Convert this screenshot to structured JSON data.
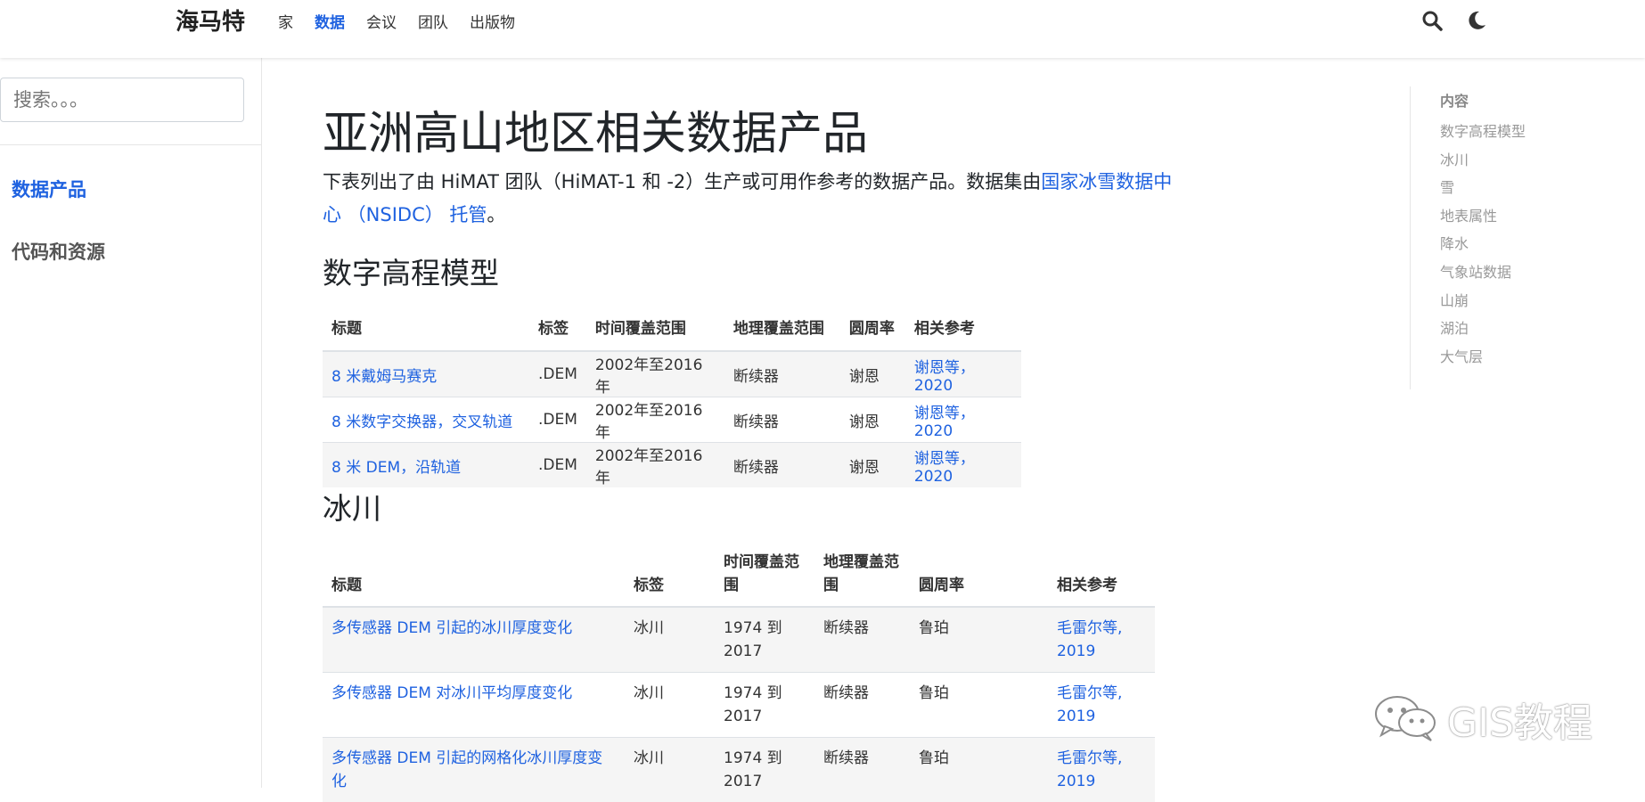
{
  "navbar": {
    "brand": "海马特",
    "links": [
      {
        "label": "家",
        "active": false
      },
      {
        "label": "数据",
        "active": true
      },
      {
        "label": "会议",
        "active": false
      },
      {
        "label": "团队",
        "active": false
      },
      {
        "label": "出版物",
        "active": false
      }
    ],
    "icons": [
      "search-icon",
      "moon-icon"
    ]
  },
  "sidebar": {
    "search_placeholder": "搜索。。。",
    "items": [
      {
        "label": "数据产品",
        "active": true
      },
      {
        "label": "代码和资源",
        "active": false
      }
    ]
  },
  "main": {
    "title": "亚洲高山地区相关数据产品",
    "intro_before": "下表列出了由 HiMAT 团队（HiMAT-1 和 -2）生产或可用作参考的数据产品。数据集由",
    "intro_link": "国家冰雪数据中心 （NSIDC） 托管",
    "intro_after": "。",
    "sections": [
      {
        "heading": "数字高程模型",
        "columns": [
          "标题",
          "标签",
          "时间覆盖范围",
          "地理覆盖范围",
          "圆周率",
          "相关参考"
        ],
        "rows": [
          {
            "title": "8 米戴姆马赛克",
            "tag": ".DEM",
            "time": "2002年至2016年",
            "geo": "断续器",
            "pi": "谢恩",
            "ref": "谢恩等， 2020"
          },
          {
            "title": "8 米数字交换器，交叉轨道",
            "tag": ".DEM",
            "time": "2002年至2016年",
            "geo": "断续器",
            "pi": "谢恩",
            "ref": "谢恩等， 2020"
          },
          {
            "title": "8 米 DEM，沿轨道",
            "tag": ".DEM",
            "time": "2002年至2016年",
            "geo": "断续器",
            "pi": "谢恩",
            "ref": "谢恩等， 2020"
          }
        ]
      },
      {
        "heading": "冰川",
        "columns": [
          "标题",
          "标签",
          "时间覆盖范围",
          "地理覆盖范围",
          "圆周率",
          "相关参考"
        ],
        "rows": [
          {
            "title": "多传感器 DEM 引起的冰川厚度变化",
            "tag": "冰川",
            "time": "1974 到 2017",
            "geo": "断续器",
            "pi": "鲁珀",
            "ref": "毛雷尔等, 2019"
          },
          {
            "title": "多传感器 DEM 对冰川平均厚度变化",
            "tag": "冰川",
            "time": "1974 到 2017",
            "geo": "断续器",
            "pi": "鲁珀",
            "ref": "毛雷尔等, 2019"
          },
          {
            "title": "多传感器 DEM 引起的网格化冰川厚度变化",
            "tag": "冰川",
            "time": "1974 到 2017",
            "geo": "断续器",
            "pi": "鲁珀",
            "ref": "毛雷尔等, 2019"
          }
        ]
      }
    ]
  },
  "toc": {
    "title": "内容",
    "items": [
      "数字高程模型",
      "冰川",
      "雪",
      "地表属性",
      "降水",
      "气象站数据",
      "山崩",
      "湖泊",
      "大气层"
    ]
  },
  "watermark": {
    "text": "GIS教程",
    "icon": "wechat-icon"
  },
  "colors": {
    "accent": "#1f62e0",
    "text": "#212529",
    "muted": "#999999"
  }
}
